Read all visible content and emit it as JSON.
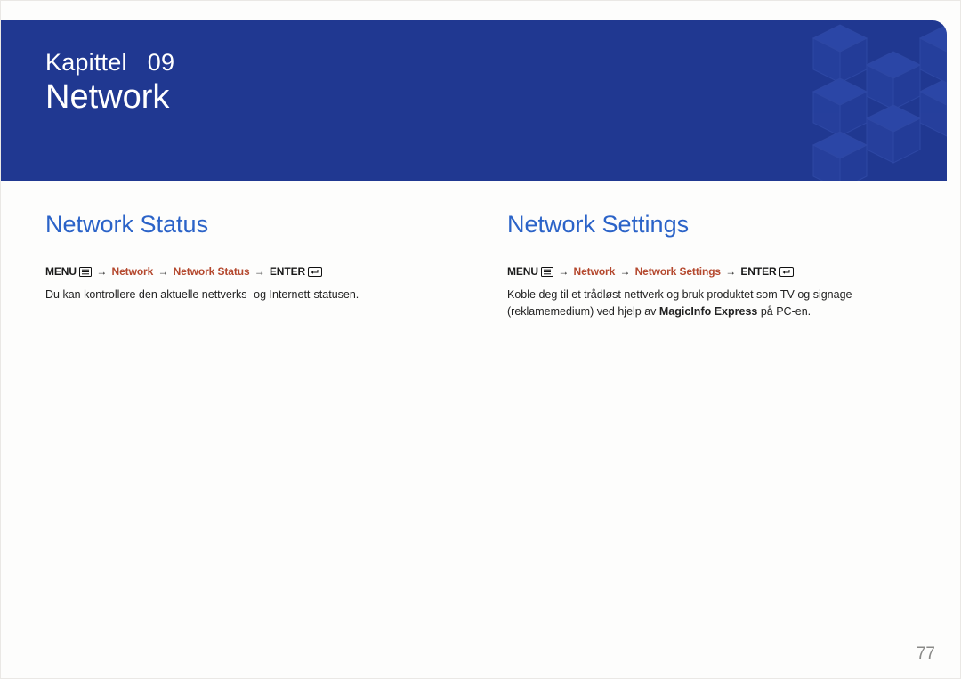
{
  "header": {
    "chapter_label": "Kapittel",
    "chapter_number": "09",
    "chapter_title": "Network"
  },
  "left": {
    "heading": "Network Status",
    "path": {
      "menu": "MENU",
      "arrow": "→",
      "crumb1": "Network",
      "crumb2": "Network Status",
      "enter": "ENTER"
    },
    "desc": "Du kan kontrollere den aktuelle nettverks- og Internett-statusen."
  },
  "right": {
    "heading": "Network Settings",
    "path": {
      "menu": "MENU",
      "arrow": "→",
      "crumb1": "Network",
      "crumb2": "Network Settings",
      "enter": "ENTER"
    },
    "desc_pre": "Koble deg til et trådløst nettverk og bruk produktet som TV og signage (reklamemedium) ved hjelp av ",
    "desc_bold": "MagicInfo Express",
    "desc_post": "  på PC-en."
  },
  "page_number": "77"
}
